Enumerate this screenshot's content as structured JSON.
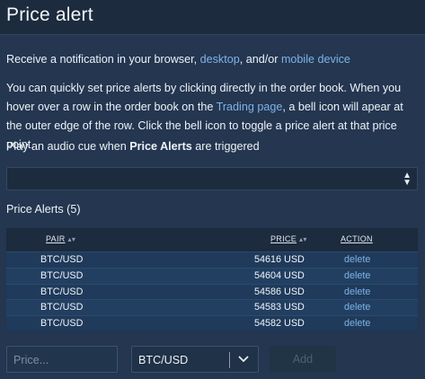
{
  "window": {
    "title": "Price alert"
  },
  "notify": {
    "prefix": "Receive a notification in your browser, ",
    "desktop_link": "desktop",
    "middle": ", and/or ",
    "mobile_link": "mobile device"
  },
  "info": {
    "part1": "You can quickly set price alerts by clicking directly in the order book. When you hover over a row in the order book on the ",
    "trading_link": "Trading page",
    "part2": ", a bell icon will apear at the outer edge of the row. Click the bell icon to toggle a price alert at that price point."
  },
  "audio": {
    "prefix": "Play an audio cue when ",
    "bold": "Price Alerts",
    "suffix": " are triggered",
    "select_value": ""
  },
  "alerts": {
    "title": "Price Alerts (5)",
    "columns": {
      "pair": "PAIR",
      "price": "PRICE",
      "action": "ACTION"
    },
    "rows": [
      {
        "pair": "BTC/USD",
        "price": "54616 USD",
        "action": "delete"
      },
      {
        "pair": "BTC/USD",
        "price": "54604 USD",
        "action": "delete"
      },
      {
        "pair": "BTC/USD",
        "price": "54586 USD",
        "action": "delete"
      },
      {
        "pair": "BTC/USD",
        "price": "54583 USD",
        "action": "delete"
      },
      {
        "pair": "BTC/USD",
        "price": "54582 USD",
        "action": "delete"
      }
    ]
  },
  "form": {
    "price_placeholder": "Price...",
    "pair_value": "BTC/USD",
    "add_label": "Add"
  },
  "colors": {
    "background": "#243650",
    "header": "#1c2b3d",
    "link": "#7eb3e6"
  }
}
